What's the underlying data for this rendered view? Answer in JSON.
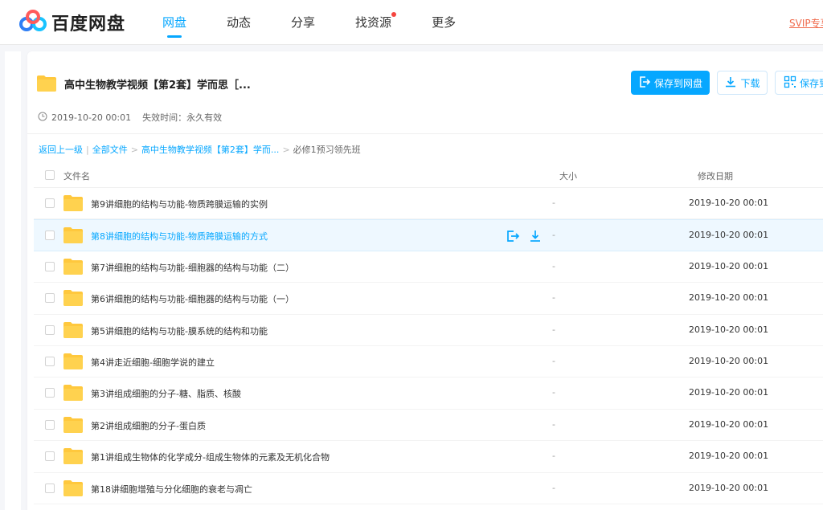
{
  "header": {
    "logo_text": "百度网盘",
    "nav": [
      {
        "label": "网盘",
        "active": true
      },
      {
        "label": "动态",
        "active": false
      },
      {
        "label": "分享",
        "active": false
      },
      {
        "label": "找资源",
        "active": false,
        "badge_dot": true
      },
      {
        "label": "更多",
        "active": false
      }
    ],
    "svip_label": "SVIP专享"
  },
  "share": {
    "title": "高中生物教学视频【第2套】学而思［...",
    "save_button": "保存到网盘",
    "download_button": "下载",
    "save_to_device_button": "保存到",
    "created": "2019-10-20 00:01",
    "expiry": "失效时间：永久有效"
  },
  "breadcrumb": {
    "back": "返回上一级",
    "all_files": "全部文件",
    "parent": "高中生物教学视频【第2套】学而...",
    "current": "必修1预习领先班",
    "separator": "|",
    "arrow": ">"
  },
  "table": {
    "col_name": "文件名",
    "col_size": "大小",
    "col_date": "修改日期",
    "rows": [
      {
        "name": "第9讲细胞的结构与功能-物质跨膜运输的实例",
        "size": "-",
        "date": "2019-10-20 00:01"
      },
      {
        "name": "第8讲细胞的结构与功能-物质跨膜运输的方式",
        "size": "-",
        "date": "2019-10-20 00:01"
      },
      {
        "name": "第7讲细胞的结构与功能-细胞器的结构与功能（二）",
        "size": "-",
        "date": "2019-10-20 00:01"
      },
      {
        "name": "第6讲细胞的结构与功能-细胞器的结构与功能（一）",
        "size": "-",
        "date": "2019-10-20 00:01"
      },
      {
        "name": "第5讲细胞的结构与功能-膜系统的结构和功能",
        "size": "-",
        "date": "2019-10-20 00:01"
      },
      {
        "name": "第4讲走近细胞-细胞学说的建立",
        "size": "-",
        "date": "2019-10-20 00:01"
      },
      {
        "name": "第3讲组成细胞的分子-糖、脂质、核酸",
        "size": "-",
        "date": "2019-10-20 00:01"
      },
      {
        "name": "第2讲组成细胞的分子-蛋白质",
        "size": "-",
        "date": "2019-10-20 00:01"
      },
      {
        "name": "第1讲组成生物体的化学成分-组成生物体的元素及无机化合物",
        "size": "-",
        "date": "2019-10-20 00:01"
      },
      {
        "name": "第18讲细胞增殖与分化细胞的衰老与凋亡",
        "size": "-",
        "date": "2019-10-20 00:01"
      }
    ],
    "hover_row": 1
  },
  "icons": {
    "logo": "baidu-netdisk-logo-icon",
    "folder": "folder-icon",
    "clock": "clock-icon",
    "save": "save-to-cloud-icon",
    "download": "download-icon",
    "qr": "qr-code-icon"
  },
  "colors": {
    "accent": "#06a7ff",
    "folder": "#ffc83d",
    "svip": "#f0694a",
    "badge": "#f5453f"
  }
}
